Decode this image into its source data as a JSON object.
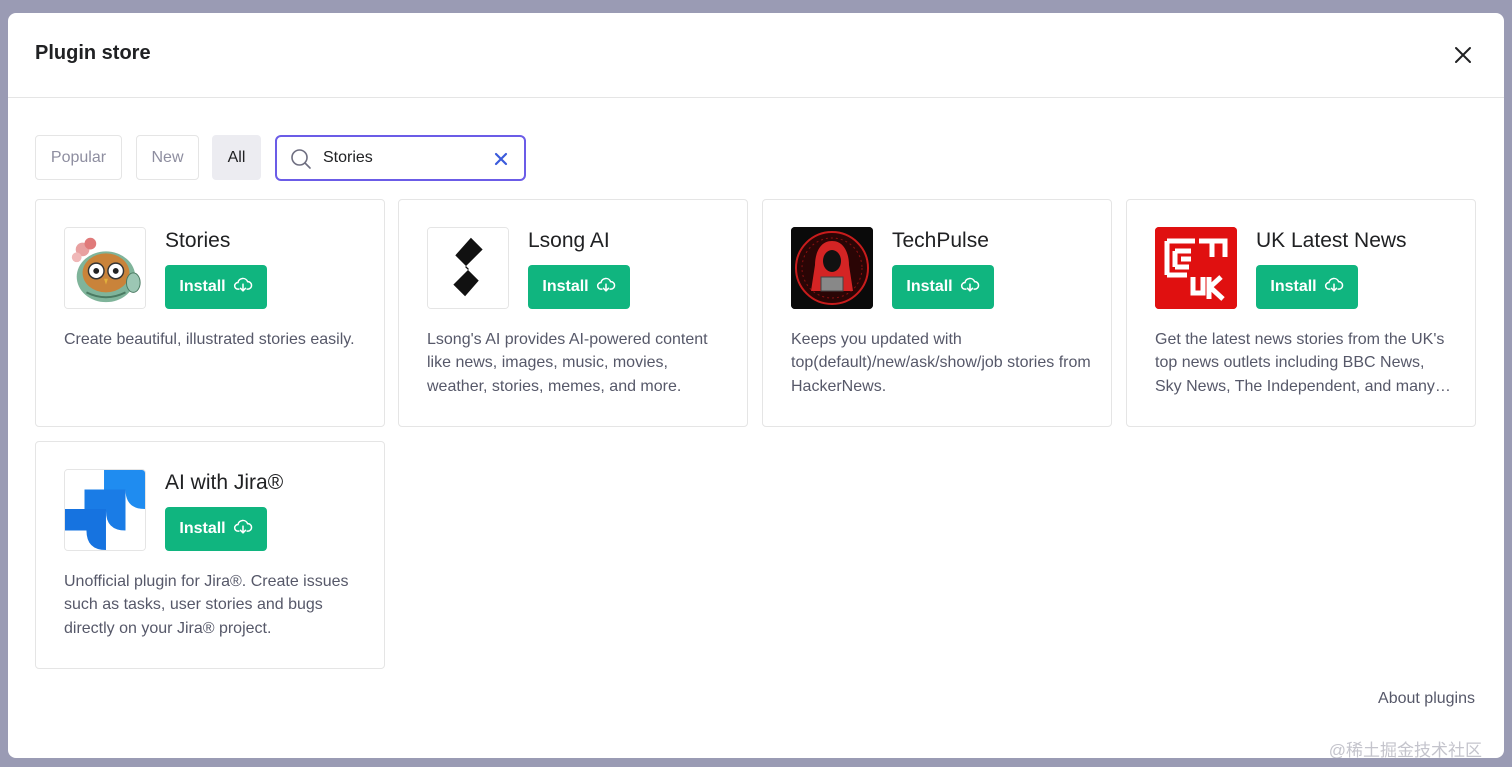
{
  "modal": {
    "title": "Plugin store",
    "close_icon": "close-icon"
  },
  "filters": {
    "popular": "Popular",
    "new": "New",
    "all": "All",
    "active": "All"
  },
  "search": {
    "value": "Stories",
    "icon": "search-icon",
    "clear_icon": "clear-icon"
  },
  "plugins": [
    {
      "name": "Stories",
      "install_label": "Install",
      "logo": "owl-illustration-logo",
      "description": "Create beautiful, illustrated stories easily."
    },
    {
      "name": "Lsong AI",
      "install_label": "Install",
      "logo": "lsong-s-logo",
      "description": "Lsong's AI provides AI-powered content like news, images, music, movies, weather, stories, memes, and more."
    },
    {
      "name": "TechPulse",
      "install_label": "Install",
      "logo": "hooded-hacker-logo",
      "description": "Keeps you updated with top(default)/new/ask/show/job stories from HackerNews."
    },
    {
      "name": "UK Latest News",
      "install_label": "Install",
      "logo": "uk-news-logo",
      "description": "Get the latest news stories from the UK's top news outlets including BBC News, Sky News, The Independent, and many others."
    },
    {
      "name": "AI with Jira®",
      "install_label": "Install",
      "logo": "jira-logo",
      "description": "Unofficial plugin for Jira®. Create issues such as tasks, user stories and bugs directly on your Jira® project."
    }
  ],
  "footer": {
    "about_link": "About plugins"
  },
  "watermark": "@稀土掘金技术社区",
  "colors": {
    "accent": "#10b57f",
    "search_border": "#6b5ce7",
    "overlay": "#9a9bb4"
  }
}
